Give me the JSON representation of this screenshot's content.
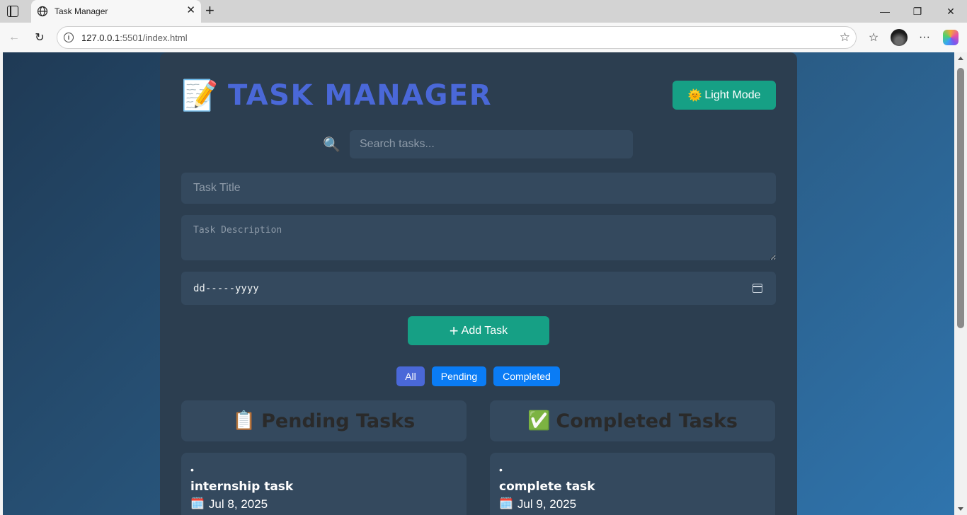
{
  "browser": {
    "tab_title": "Task Manager",
    "tab_close": "✕",
    "new_tab": "+",
    "url_host": "127.0.0.1",
    "url_rest": ":5501/index.html",
    "win_minimize": "—",
    "win_restore": "❐",
    "win_close": "✕",
    "back": "←",
    "reload": "↻",
    "star": "☆",
    "favorites": "☆",
    "more": "···",
    "info": "i"
  },
  "app": {
    "logo_icon": "📝",
    "title": "TASK MANAGER",
    "mode_button_icon": "🌞",
    "mode_button_label": "Light Mode",
    "search_icon": "🔍",
    "search_placeholder": "Search tasks...",
    "title_placeholder": "Task Title",
    "description_placeholder": "Task Description",
    "date_value": "dd-----yyyy",
    "add_button_icon": "+",
    "add_button_label": "Add Task",
    "filters": [
      {
        "label": "All",
        "color": "#4a68d8"
      },
      {
        "label": "Pending",
        "color": "#0a7cf5"
      },
      {
        "label": "Completed",
        "color": "#0a7cf5"
      }
    ],
    "columns": [
      {
        "icon": "📋",
        "heading": "Pending Tasks",
        "task": {
          "bullet": "•",
          "name": "internship task",
          "date_icon": "🗓️",
          "date": "Jul 8, 2025"
        }
      },
      {
        "icon": "✅",
        "heading": "Completed Tasks",
        "task": {
          "bullet": "•",
          "name": "complete task",
          "date_icon": "🗓️",
          "date": "Jul 9, 2025"
        }
      }
    ]
  },
  "colors": {
    "panel": "#2c3e50",
    "input_bg": "#34495e",
    "accent_teal": "#16a085",
    "title_blue": "#4a68d8"
  }
}
